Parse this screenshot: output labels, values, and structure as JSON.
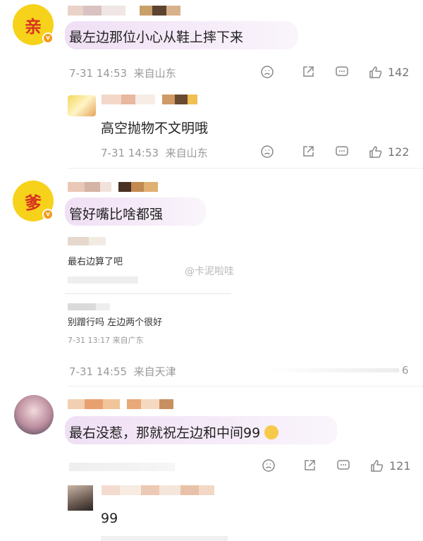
{
  "comments": [
    {
      "avatar_char": "亲",
      "text": "最左边那位小心从鞋上摔下来",
      "time": "7-31 14:53",
      "location": "来自山东",
      "likes": "142",
      "reply": {
        "text": "高空抛物不文明哦",
        "time": "7-31 14:53",
        "location": "来自山东",
        "likes": "122"
      }
    },
    {
      "avatar_char": "爹",
      "text": "管好嘴比啥都强",
      "embedded": {
        "line1": "最右边算了吧",
        "line2": "别蹭行吗 左边两个很好",
        "meta2": "7-31 13:17 来自广东"
      },
      "time": "7-31 14:55",
      "location": "来自天津",
      "tail_digit": "6"
    },
    {
      "text": "最右没惹，那就祝左边和中间99",
      "likes": "121",
      "reply": {
        "text": "99"
      }
    }
  ],
  "watermark": "@卡泥啦哇",
  "colors": {
    "accent_yellow": "#f6d21a",
    "avatar_text": "#d8321e",
    "badge": "#f29b1a",
    "meta_grey": "#999999"
  },
  "icons": [
    "dislike-icon",
    "share-icon",
    "comment-icon",
    "like-icon"
  ]
}
